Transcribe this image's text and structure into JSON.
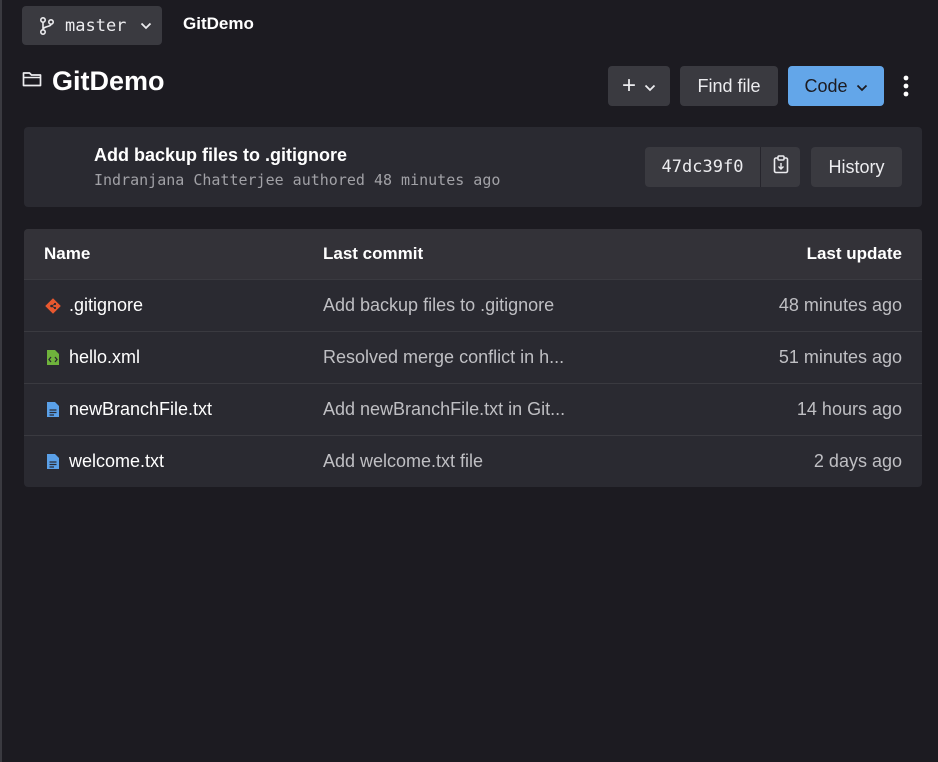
{
  "branch": {
    "label": "master",
    "icon": "git-branch-icon"
  },
  "breadcrumb": {
    "project": "GitDemo"
  },
  "header": {
    "title": "GitDemo",
    "folder_icon": "folder-icon"
  },
  "actions": {
    "add_label": "+",
    "find_file_label": "Find file",
    "code_label": "Code",
    "code_color": "#63a6e9"
  },
  "last_commit": {
    "message": "Add backup files to .gitignore",
    "meta": "Indranjana Chatterjee authored 48 minutes ago",
    "sha": "47dc39f0",
    "history_label": "History"
  },
  "file_table": {
    "columns": [
      "Name",
      "Last commit",
      "Last update"
    ],
    "rows": [
      {
        "name": ".gitignore",
        "icon": "git-icon",
        "commit": "Add backup files to .gitignore",
        "updated": "48 minutes ago"
      },
      {
        "name": "hello.xml",
        "icon": "xml-file-icon",
        "commit": "Resolved merge conflict in h...",
        "updated": "51 minutes ago"
      },
      {
        "name": "newBranchFile.txt",
        "icon": "text-file-icon",
        "commit": "Add newBranchFile.txt in Git...",
        "updated": "14 hours ago"
      },
      {
        "name": "welcome.txt",
        "icon": "text-file-icon",
        "commit": "Add welcome.txt file",
        "updated": "2 days ago"
      }
    ]
  },
  "colors": {
    "background": "#1c1b21",
    "panel": "#2a2a31",
    "button": "#3a3a40",
    "git_icon": "#e8582f",
    "xml_icon": "#6fb33c",
    "text_icon": "#5aa0e8"
  }
}
